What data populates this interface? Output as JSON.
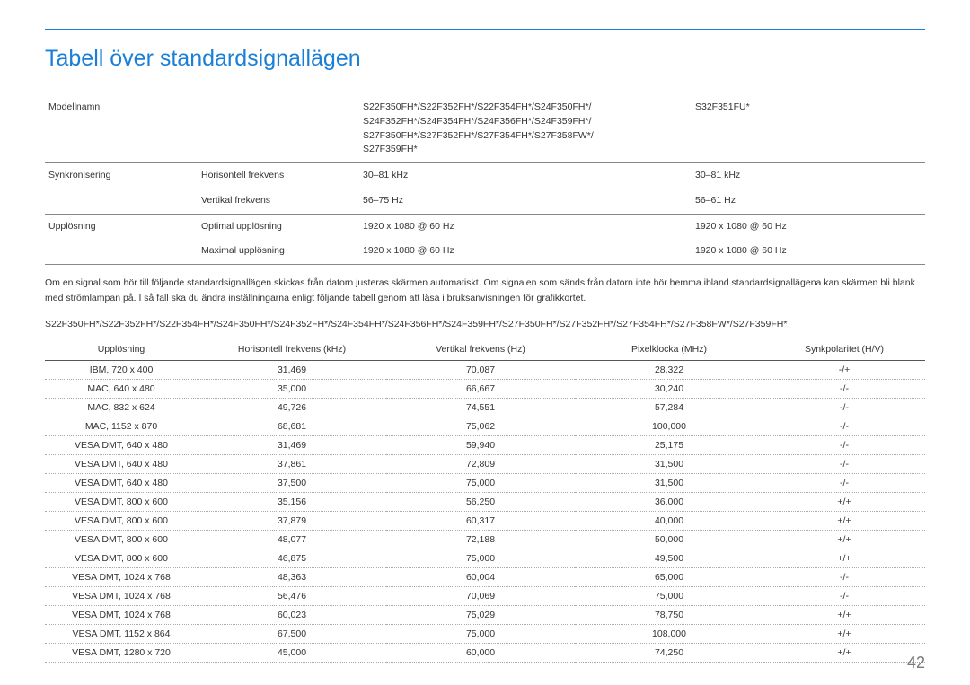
{
  "title": "Tabell över standardsignallägen",
  "spec": {
    "model_label": "Modellnamn",
    "model_a": "S22F350FH*/S22F352FH*/S22F354FH*/S24F350FH*/\nS24F352FH*/S24F354FH*/S24F356FH*/S24F359FH*/\nS27F350FH*/S27F352FH*/S27F354FH*/S27F358FW*/\nS27F359FH*",
    "model_b": "S32F351FU*",
    "sync_label": "Synkronisering",
    "hfreq_label": "Horisontell frekvens",
    "hfreq_a": "30–81 kHz",
    "hfreq_b": "30–81 kHz",
    "vfreq_label": "Vertikal frekvens",
    "vfreq_a": "56–75 Hz",
    "vfreq_b": "56–61 Hz",
    "res_label": "Upplösning",
    "opt_label": "Optimal upplösning",
    "opt_a": "1920 x 1080 @ 60 Hz",
    "opt_b": "1920 x 1080 @ 60 Hz",
    "max_label": "Maximal upplösning",
    "max_a": "1920 x 1080 @ 60 Hz",
    "max_b": "1920 x 1080 @ 60 Hz"
  },
  "note": "Om en signal som hör till följande standardsignallägen skickas från datorn justeras skärmen automatiskt. Om signalen som sänds från datorn inte hör hemma ibland standardsignallägena kan skärmen bli blank med strömlampan på. I så fall ska du ändra inställningarna enligt följande tabell genom att läsa i bruksanvisningen för grafikkortet.",
  "models_line": "S22F350FH*/S22F352FH*/S22F354FH*/S24F350FH*/S24F352FH*/S24F354FH*/S24F356FH*/S24F359FH*/S27F350FH*/S27F352FH*/S27F354FH*/S27F358FW*/S27F359FH*",
  "signal_headers": {
    "c1": "Upplösning",
    "c2": "Horisontell frekvens (kHz)",
    "c3": "Vertikal frekvens (Hz)",
    "c4": "Pixelklocka (MHz)",
    "c5": "Synkpolaritet (H/V)"
  },
  "signal_rows": [
    {
      "c1": "IBM, 720 x 400",
      "c2": "31,469",
      "c3": "70,087",
      "c4": "28,322",
      "c5": "-/+"
    },
    {
      "c1": "MAC, 640 x 480",
      "c2": "35,000",
      "c3": "66,667",
      "c4": "30,240",
      "c5": "-/-"
    },
    {
      "c1": "MAC, 832 x 624",
      "c2": "49,726",
      "c3": "74,551",
      "c4": "57,284",
      "c5": "-/-"
    },
    {
      "c1": "MAC, 1152 x 870",
      "c2": "68,681",
      "c3": "75,062",
      "c4": "100,000",
      "c5": "-/-"
    },
    {
      "c1": "VESA DMT, 640 x 480",
      "c2": "31,469",
      "c3": "59,940",
      "c4": "25,175",
      "c5": "-/-"
    },
    {
      "c1": "VESA DMT, 640 x 480",
      "c2": "37,861",
      "c3": "72,809",
      "c4": "31,500",
      "c5": "-/-"
    },
    {
      "c1": "VESA DMT, 640 x 480",
      "c2": "37,500",
      "c3": "75,000",
      "c4": "31,500",
      "c5": "-/-"
    },
    {
      "c1": "VESA DMT, 800 x 600",
      "c2": "35,156",
      "c3": "56,250",
      "c4": "36,000",
      "c5": "+/+"
    },
    {
      "c1": "VESA DMT, 800 x 600",
      "c2": "37,879",
      "c3": "60,317",
      "c4": "40,000",
      "c5": "+/+"
    },
    {
      "c1": "VESA DMT, 800 x 600",
      "c2": "48,077",
      "c3": "72,188",
      "c4": "50,000",
      "c5": "+/+"
    },
    {
      "c1": "VESA DMT, 800 x 600",
      "c2": "46,875",
      "c3": "75,000",
      "c4": "49,500",
      "c5": "+/+"
    },
    {
      "c1": "VESA DMT, 1024 x 768",
      "c2": "48,363",
      "c3": "60,004",
      "c4": "65,000",
      "c5": "-/-"
    },
    {
      "c1": "VESA DMT, 1024 x 768",
      "c2": "56,476",
      "c3": "70,069",
      "c4": "75,000",
      "c5": "-/-"
    },
    {
      "c1": "VESA DMT, 1024 x 768",
      "c2": "60,023",
      "c3": "75,029",
      "c4": "78,750",
      "c5": "+/+"
    },
    {
      "c1": "VESA DMT, 1152 x 864",
      "c2": "67,500",
      "c3": "75,000",
      "c4": "108,000",
      "c5": "+/+"
    },
    {
      "c1": "VESA DMT, 1280 x 720",
      "c2": "45,000",
      "c3": "60,000",
      "c4": "74,250",
      "c5": "+/+"
    }
  ],
  "page_number": "42"
}
